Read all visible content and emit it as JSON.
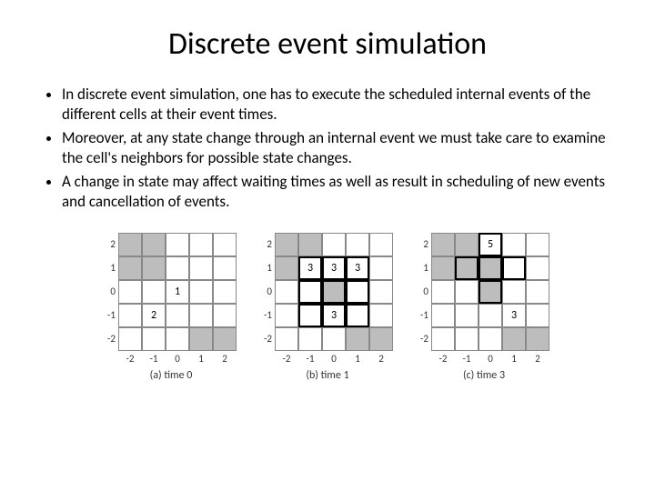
{
  "title": "Discrete event simulation",
  "bullets": [
    "In discrete event simulation, one has to execute the scheduled internal events of the different cells at their event times.",
    "Moreover, at any state change through an internal event we must take care to examine the cell's neighbors for possible state changes.",
    "A change in state may affect waiting times as well as result in scheduling of new events and cancellation of events."
  ],
  "axis": {
    "y": [
      "2",
      "1",
      "0",
      "-1",
      "-2"
    ],
    "x": [
      "-2",
      "-1",
      "0",
      "1",
      "2"
    ]
  },
  "panels": [
    {
      "caption": "(a) time 0",
      "cells": [
        [
          {
            "s": 1
          },
          {
            "s": 1
          },
          {
            "s": 0
          },
          {
            "s": 0
          },
          {
            "s": 0
          }
        ],
        [
          {
            "s": 1
          },
          {
            "s": 1
          },
          {
            "s": 0
          },
          {
            "s": 0
          },
          {
            "s": 0
          }
        ],
        [
          {
            "s": 0
          },
          {
            "s": 0
          },
          {
            "s": 0,
            "v": "1"
          },
          {
            "s": 0
          },
          {
            "s": 0
          }
        ],
        [
          {
            "s": 0
          },
          {
            "s": 0,
            "v": "2"
          },
          {
            "s": 0
          },
          {
            "s": 0
          },
          {
            "s": 0
          }
        ],
        [
          {
            "s": 0
          },
          {
            "s": 0
          },
          {
            "s": 0
          },
          {
            "s": 1
          },
          {
            "s": 1
          }
        ]
      ]
    },
    {
      "caption": "(b) time 1",
      "cells": [
        [
          {
            "s": 1
          },
          {
            "s": 1
          },
          {
            "s": 0
          },
          {
            "s": 0
          },
          {
            "s": 0
          }
        ],
        [
          {
            "s": 1
          },
          {
            "s": 0,
            "v": "3",
            "b": 1
          },
          {
            "s": 0,
            "v": "3",
            "b": 1
          },
          {
            "s": 0,
            "v": "3",
            "b": 1
          },
          {
            "s": 0
          }
        ],
        [
          {
            "s": 0
          },
          {
            "s": 0,
            "b": 1
          },
          {
            "s": 1,
            "b": 1
          },
          {
            "s": 0,
            "b": 1
          },
          {
            "s": 0
          }
        ],
        [
          {
            "s": 0
          },
          {
            "s": 0,
            "b": 1
          },
          {
            "s": 0,
            "v": "3",
            "b": 1
          },
          {
            "s": 0,
            "b": 1
          },
          {
            "s": 0
          }
        ],
        [
          {
            "s": 0
          },
          {
            "s": 0
          },
          {
            "s": 0
          },
          {
            "s": 1
          },
          {
            "s": 1
          }
        ]
      ]
    },
    {
      "caption": "(c) time 3",
      "cells": [
        [
          {
            "s": 1
          },
          {
            "s": 1
          },
          {
            "s": 0,
            "v": "5",
            "b": 1
          },
          {
            "s": 0
          },
          {
            "s": 0
          }
        ],
        [
          {
            "s": 1
          },
          {
            "s": 1,
            "b": 1
          },
          {
            "s": 1,
            "b": 1
          },
          {
            "s": 0,
            "b": 1
          },
          {
            "s": 0
          }
        ],
        [
          {
            "s": 0
          },
          {
            "s": 0
          },
          {
            "s": 1,
            "b": 1
          },
          {
            "s": 0
          },
          {
            "s": 0
          }
        ],
        [
          {
            "s": 0
          },
          {
            "s": 0
          },
          {
            "s": 0
          },
          {
            "s": 0,
            "v": "3"
          },
          {
            "s": 0
          }
        ],
        [
          {
            "s": 0
          },
          {
            "s": 0
          },
          {
            "s": 0
          },
          {
            "s": 1
          },
          {
            "s": 1
          }
        ]
      ]
    }
  ]
}
